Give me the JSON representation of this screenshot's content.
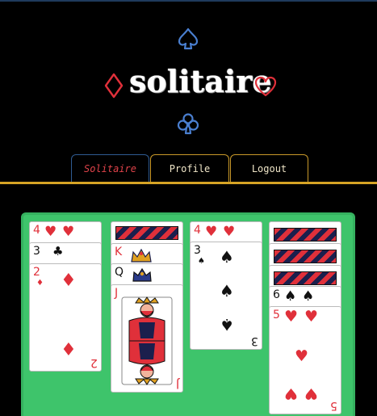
{
  "app": {
    "title": "solitaire"
  },
  "nav": {
    "tabs": [
      {
        "label": "Solitaire",
        "active": true
      },
      {
        "label": "Profile",
        "active": false
      },
      {
        "label": "Logout",
        "active": false
      }
    ]
  },
  "colors": {
    "background": "#000000",
    "accent_gold": "#d6a425",
    "accent_blue": "#4a7fd0",
    "suit_red": "#e0303a",
    "board_green": "#3ec46b"
  },
  "decor": {
    "top_icon": "spade-outline-icon",
    "left_icon": "diamond-outline-icon",
    "right_icon": "heart-outline-icon",
    "bottom_icon": "club-outline-icon"
  },
  "tableau": {
    "col1": [
      "4",
      "3",
      "2"
    ],
    "col2": [
      "K",
      "Q",
      "J"
    ],
    "col3": [
      "4",
      "3"
    ],
    "col4": [
      "6",
      "5"
    ]
  }
}
